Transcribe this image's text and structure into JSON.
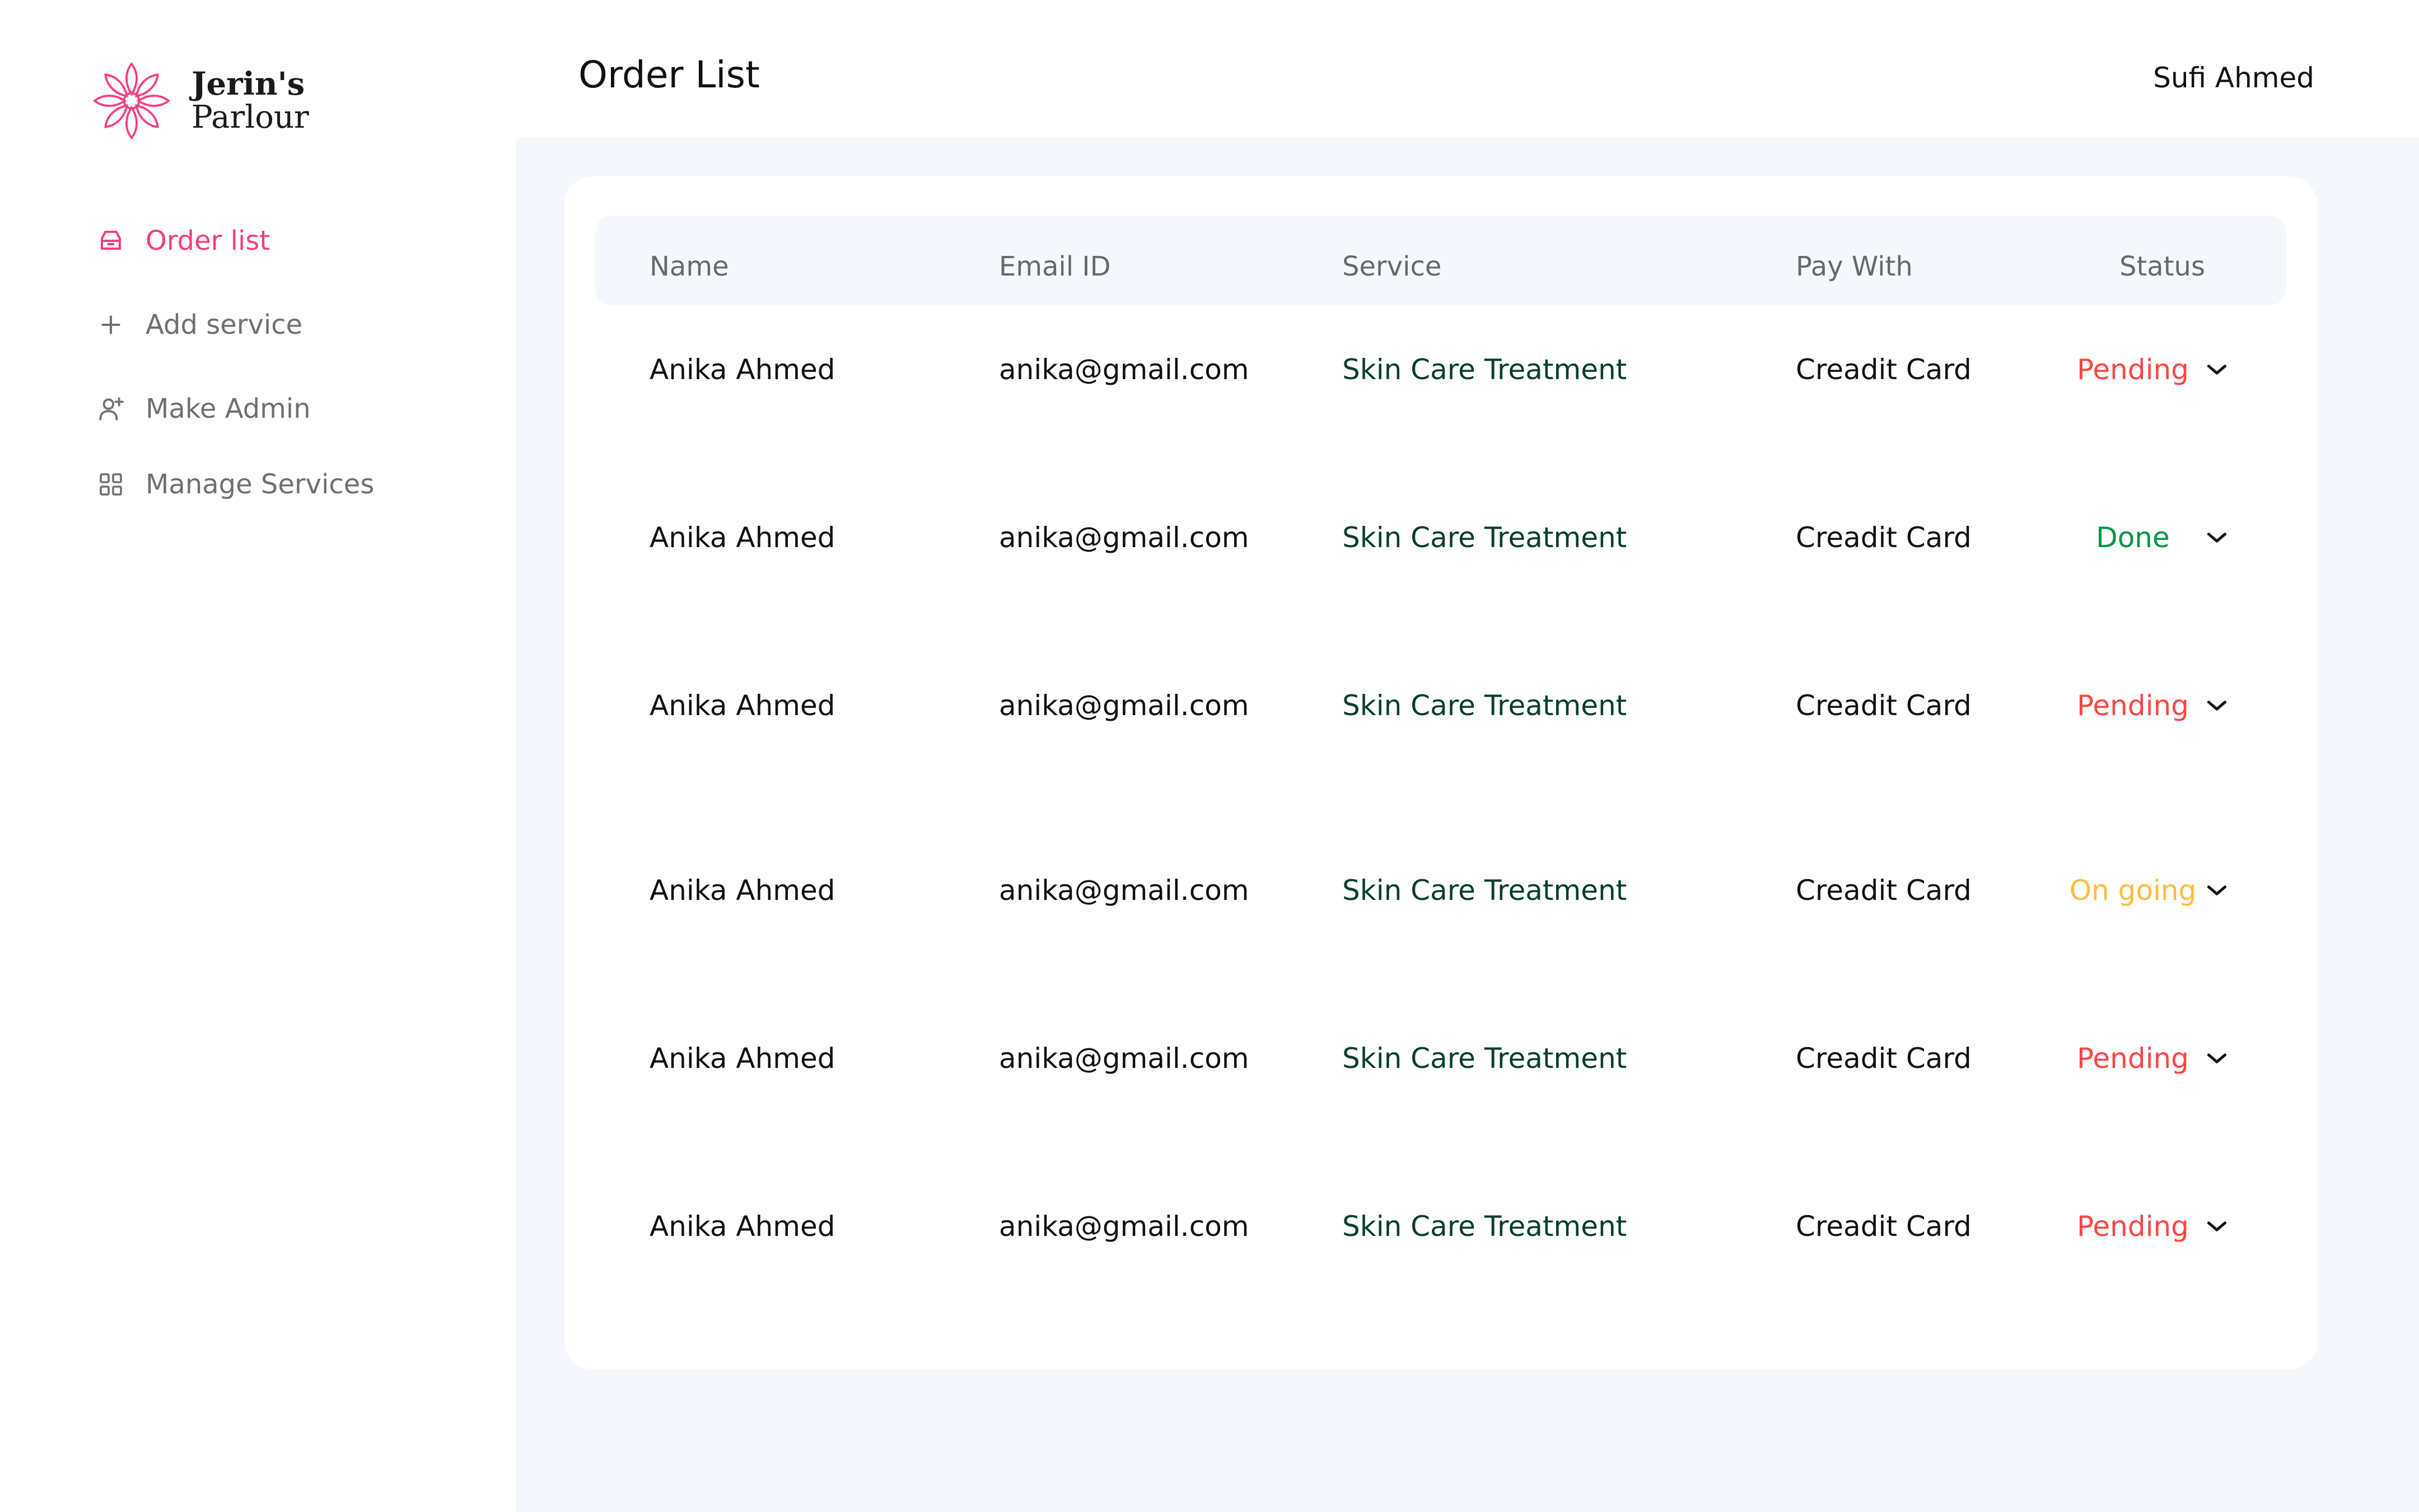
{
  "brand": {
    "line1": "Jerin's",
    "line2": "Parlour",
    "accent": "#f63e7b"
  },
  "sidebar": {
    "items": [
      {
        "label": "Order list",
        "icon": "inbox-icon",
        "active": true
      },
      {
        "label": "Add service",
        "icon": "plus-icon",
        "active": false
      },
      {
        "label": "Make Admin",
        "icon": "user-plus-icon",
        "active": false
      },
      {
        "label": "Manage Services",
        "icon": "grid-icon",
        "active": false
      }
    ]
  },
  "header": {
    "title": "Order List",
    "user": "Sufi Ahmed"
  },
  "table": {
    "columns": [
      "Name",
      "Email ID",
      "Service",
      "Pay With",
      "Status"
    ],
    "rows": [
      {
        "name": "Anika Ahmed",
        "email": "anika@gmail.com",
        "service": "Skin Care Treatment",
        "pay": "Creadit Card",
        "status": "Pending"
      },
      {
        "name": "Anika Ahmed",
        "email": "anika@gmail.com",
        "service": "Skin Care Treatment",
        "pay": "Creadit Card",
        "status": "Done"
      },
      {
        "name": "Anika Ahmed",
        "email": "anika@gmail.com",
        "service": "Skin Care Treatment",
        "pay": "Creadit Card",
        "status": "Pending"
      },
      {
        "name": "Anika Ahmed",
        "email": "anika@gmail.com",
        "service": "Skin Care Treatment",
        "pay": "Creadit Card",
        "status": "On going"
      },
      {
        "name": "Anika Ahmed",
        "email": "anika@gmail.com",
        "service": "Skin Care Treatment",
        "pay": "Creadit Card",
        "status": "Pending"
      },
      {
        "name": "Anika Ahmed",
        "email": "anika@gmail.com",
        "service": "Skin Care Treatment",
        "pay": "Creadit Card",
        "status": "Pending"
      }
    ]
  },
  "status_colors": {
    "Pending": "#ff4545",
    "Done": "#009444",
    "On going": "#ffbd3e"
  }
}
